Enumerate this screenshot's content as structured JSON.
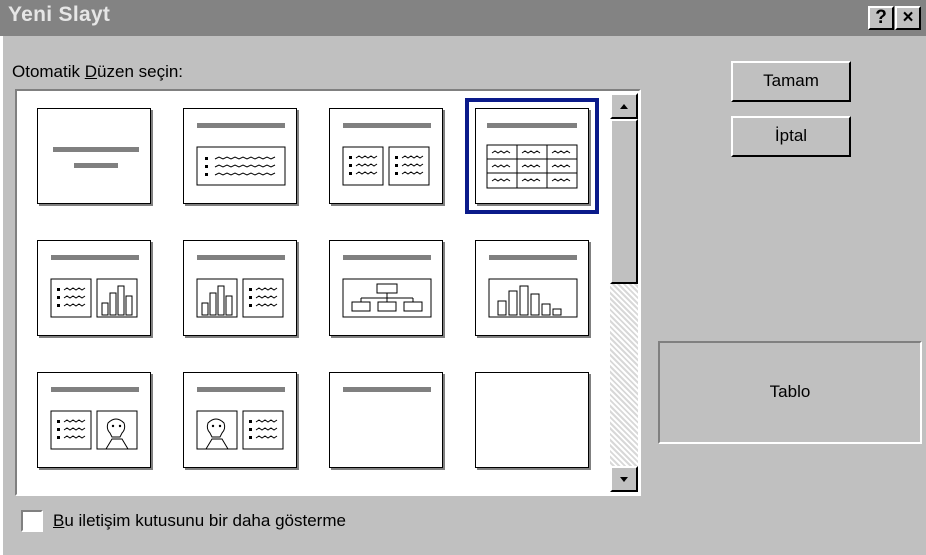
{
  "dialog": {
    "title": "Yeni Slayt",
    "help_label": "?",
    "close_label": "×"
  },
  "layout_picker": {
    "prompt_prefix": "Otomatik ",
    "prompt_mnemonic": "D",
    "prompt_suffix": "üzen seçin:",
    "selected": "Tablo",
    "layouts": [
      "title-slide",
      "bulleted-list",
      "two-column-text",
      "table",
      "text-and-chart",
      "chart-and-text",
      "organization-chart",
      "chart",
      "text-and-clip-art",
      "clip-art-and-text",
      "title-only",
      "blank"
    ]
  },
  "buttons": {
    "ok": "Tamam",
    "cancel": "İptal"
  },
  "preview": {
    "label": "Tablo"
  },
  "dont_show": {
    "checked": false,
    "label_mnemonic": "B",
    "label_rest": "u iletişim kutusunu bir daha gösterme"
  },
  "colors": {
    "face": "#c0c0c0",
    "titlebar_inactive": "#838383",
    "selection_border": "#0a1a8a"
  }
}
